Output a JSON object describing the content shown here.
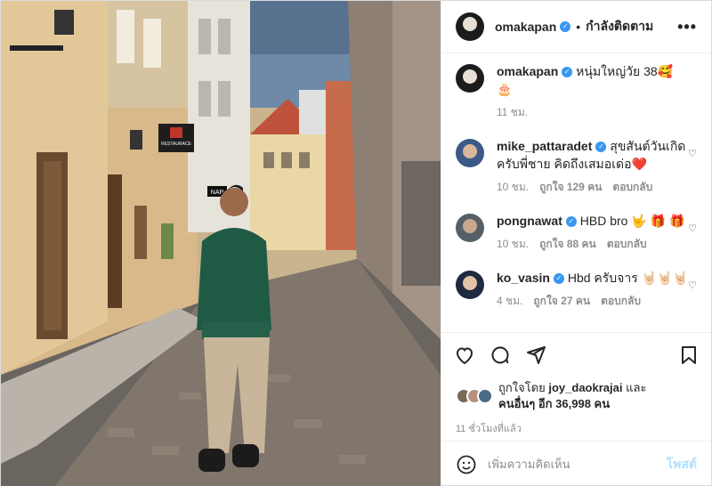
{
  "header": {
    "username": "omakapan",
    "separator": "•",
    "follow_status": "กำลังติดตาม",
    "more": "•••"
  },
  "caption": {
    "username": "omakapan",
    "text": "หนุ่มใหญ่วัย 38🥰",
    "text2": "🎂",
    "time": "11 ชม."
  },
  "comments": [
    {
      "username": "mike_pattaradet",
      "text": "สุขสันต์วันเกิดครับพี่ชาย คิดถึงเสมอเด่อ❤️",
      "time": "10 ชม.",
      "likes": "ถูกใจ 129 คน",
      "reply": "ตอบกลับ"
    },
    {
      "username": "pongnawat",
      "text": "HBD bro 🤟 🎁 🎁",
      "time": "10 ชม.",
      "likes": "ถูกใจ 88 คน",
      "reply": "ตอบกลับ"
    },
    {
      "username": "ko_vasin",
      "text": "Hbd ครับจาร 🤘🏻🤘🏻🤘🏻",
      "time": "4 ชม.",
      "likes": "ถูกใจ 27 คน",
      "reply": "ตอบกลับ"
    }
  ],
  "likes": {
    "prefix": "ถูกใจโดย",
    "user": "joy_daokrajai",
    "and": "และ",
    "others": "คนอื่นๆ อีก 36,998 คน"
  },
  "post_time": "11 ชั่วโมงที่แล้ว",
  "comment_box": {
    "placeholder": "เพิ่มความคิดเห็น",
    "post_label": "โพสต์"
  },
  "photo_signs": {
    "restaurant": "RESTAURACE",
    "nap": "NAP"
  },
  "colors": {
    "verified": "#3897f0",
    "post_button": "#b2dffc",
    "meta": "#8e8e8e"
  }
}
